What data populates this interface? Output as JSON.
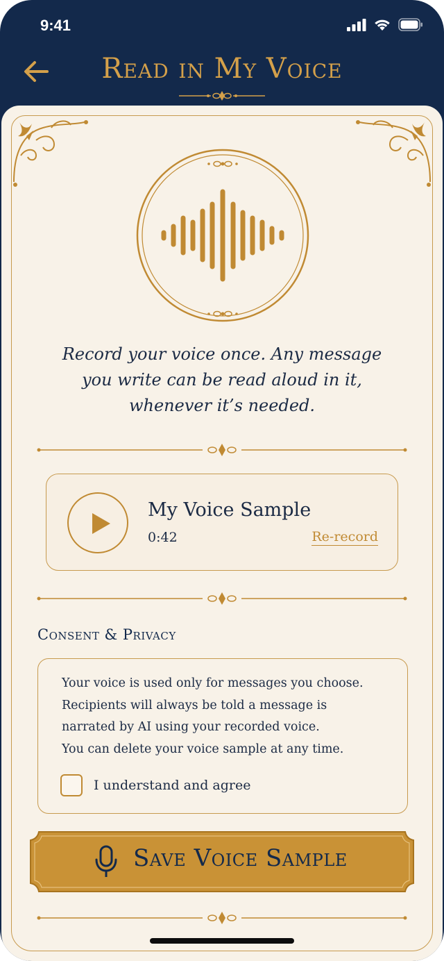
{
  "status_bar": {
    "time": "9:41"
  },
  "header": {
    "title": "Read in My Voice",
    "back_icon": "arrow-left-icon"
  },
  "intro": {
    "lines": [
      "Record your voice once. Any message",
      "you write can be read aloud in it,",
      "whenever it’s needed."
    ]
  },
  "voice_sample": {
    "title": "My Voice Sample",
    "duration": "0:42",
    "rerecord_label": "Re-record",
    "play_icon": "play-icon"
  },
  "consent": {
    "heading": "Consent & Privacy",
    "lines": [
      "Your voice is used only for messages you choose.",
      "Recipients will always be told a message is",
      "narrated by AI using your recorded voice.",
      "You can delete your voice sample at any time."
    ],
    "agree_label": "I understand and agree",
    "agreed": false
  },
  "save_button": {
    "label": "Save Voice Sample",
    "icon": "microphone-icon"
  },
  "colors": {
    "navy": "#13294b",
    "gold": "#c08a33",
    "gold_light": "#d4a04a",
    "parchment": "#f8f2e8",
    "text": "#1b2a44"
  }
}
